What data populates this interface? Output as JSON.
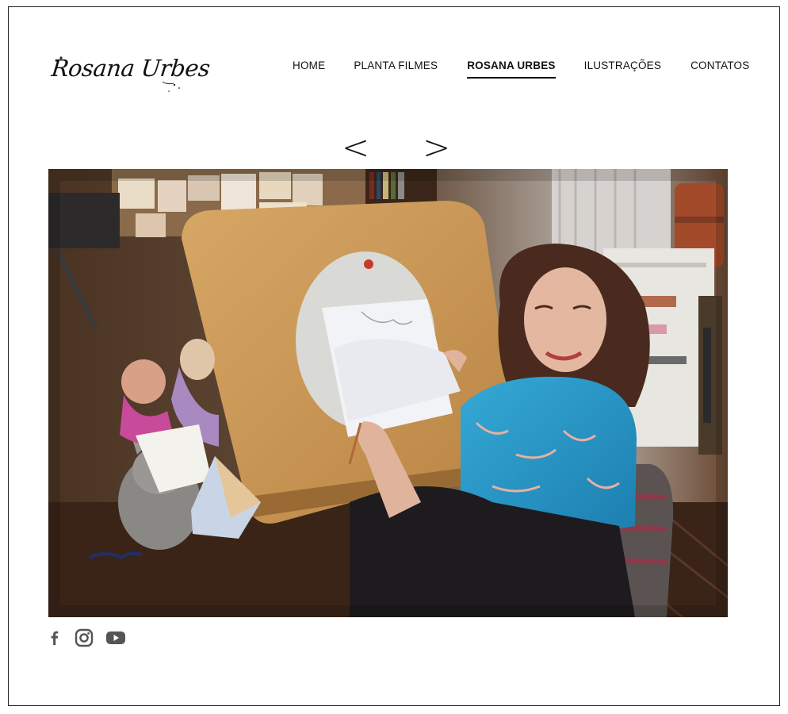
{
  "brand": {
    "logo_text": "Rosana Urbes"
  },
  "nav": {
    "items": [
      {
        "label": "HOME",
        "active": false
      },
      {
        "label": "PLANTA FILMES",
        "active": false
      },
      {
        "label": "ROSANA URBES",
        "active": true
      },
      {
        "label": "ILUSTRAÇÕES",
        "active": false
      },
      {
        "label": "CONTATOS",
        "active": false
      }
    ]
  },
  "slider": {
    "prev_label": "<",
    "next_label": ">"
  },
  "social": {
    "icons": [
      "facebook-icon",
      "instagram-icon",
      "youtube-icon"
    ]
  },
  "colors": {
    "text": "#111111",
    "icon": "#555555",
    "scarf": "#2d9ac8",
    "board": "#c89a5a"
  }
}
